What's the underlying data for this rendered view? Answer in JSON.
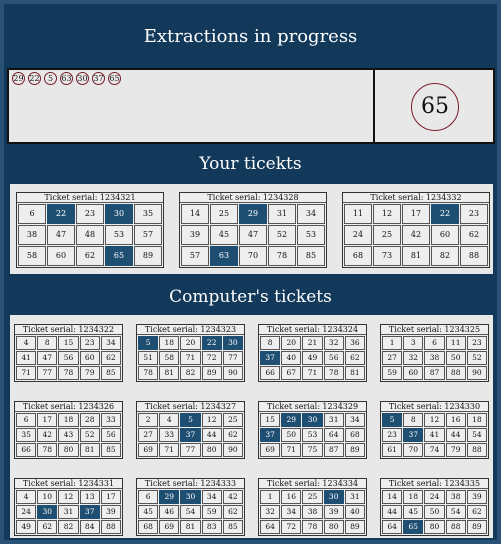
{
  "header": {
    "title": "Extractions in progress"
  },
  "extractions": {
    "drawn": [
      29,
      22,
      5,
      63,
      30,
      37,
      65
    ],
    "current": 65
  },
  "your_section": {
    "title": "Your ticekts"
  },
  "computer_section": {
    "title": "Computer's tickets"
  },
  "your_tickets": [
    {
      "serial": "Ticket serial: 1234321",
      "numbers": [
        6,
        22,
        23,
        30,
        35,
        38,
        47,
        48,
        53,
        57,
        58,
        60,
        62,
        65,
        89
      ]
    },
    {
      "serial": "Ticket serial: 1234328",
      "numbers": [
        14,
        25,
        29,
        31,
        34,
        39,
        45,
        47,
        52,
        53,
        57,
        63,
        70,
        78,
        85
      ]
    },
    {
      "serial": "Ticket serial: 1234332",
      "numbers": [
        11,
        12,
        17,
        22,
        23,
        24,
        25,
        42,
        60,
        62,
        68,
        73,
        81,
        82,
        88
      ]
    }
  ],
  "computer_tickets": [
    {
      "serial": "Ticket serial: 1234322",
      "numbers": [
        4,
        8,
        15,
        23,
        34,
        41,
        47,
        56,
        60,
        62,
        71,
        77,
        78,
        79,
        85
      ]
    },
    {
      "serial": "Ticket serial: 1234323",
      "numbers": [
        5,
        18,
        20,
        22,
        30,
        51,
        58,
        71,
        72,
        77,
        78,
        81,
        82,
        89,
        90
      ]
    },
    {
      "serial": "Ticket serial: 1234324",
      "numbers": [
        8,
        20,
        21,
        32,
        36,
        37,
        40,
        49,
        56,
        62,
        66,
        67,
        71,
        78,
        81
      ]
    },
    {
      "serial": "Ticket serial: 1234325",
      "numbers": [
        1,
        3,
        6,
        11,
        23,
        27,
        32,
        38,
        50,
        52,
        59,
        60,
        87,
        88,
        90
      ]
    },
    {
      "serial": "Ticket serial: 1234326",
      "numbers": [
        6,
        17,
        18,
        28,
        33,
        35,
        42,
        43,
        52,
        56,
        66,
        78,
        80,
        81,
        85
      ]
    },
    {
      "serial": "Ticket serial: 1234327",
      "numbers": [
        2,
        4,
        5,
        12,
        25,
        27,
        33,
        37,
        44,
        62,
        69,
        71,
        77,
        80,
        90
      ]
    },
    {
      "serial": "Ticket serial: 1234329",
      "numbers": [
        15,
        29,
        30,
        31,
        34,
        37,
        50,
        53,
        64,
        68,
        69,
        71,
        75,
        87,
        89
      ]
    },
    {
      "serial": "Ticket serial: 1234330",
      "numbers": [
        5,
        8,
        12,
        16,
        18,
        23,
        37,
        41,
        44,
        54,
        61,
        70,
        74,
        79,
        88
      ]
    },
    {
      "serial": "Ticket serial: 1234331",
      "numbers": [
        4,
        10,
        12,
        13,
        17,
        24,
        30,
        31,
        37,
        39,
        49,
        62,
        82,
        84,
        88
      ]
    },
    {
      "serial": "Ticket serial: 1234333",
      "numbers": [
        6,
        29,
        30,
        34,
        42,
        45,
        46,
        54,
        59,
        62,
        68,
        69,
        81,
        83,
        85
      ]
    },
    {
      "serial": "Ticket serial: 1234334",
      "numbers": [
        1,
        16,
        25,
        30,
        31,
        32,
        34,
        38,
        39,
        40,
        64,
        72,
        78,
        80,
        89
      ]
    },
    {
      "serial": "Ticket serial: 1234335",
      "numbers": [
        14,
        18,
        24,
        38,
        39,
        44,
        45,
        50,
        54,
        62,
        64,
        65,
        80,
        88,
        89
      ]
    }
  ]
}
